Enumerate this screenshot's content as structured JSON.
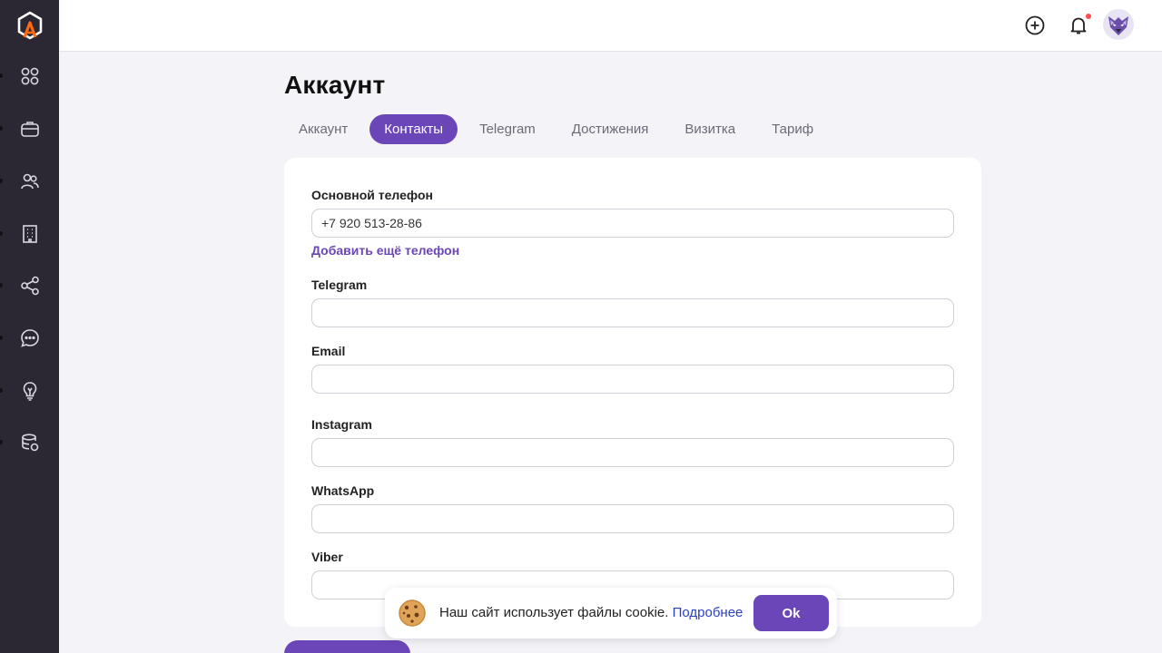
{
  "page": {
    "title": "Аккаунт"
  },
  "colors": {
    "accent": "#6b46b8",
    "sidebar_bg": "#2b2833",
    "logo_orange": "#ff6a13",
    "link_blue": "#2a3fbf",
    "notification_dot": "#ff4d4f"
  },
  "sidebar": {
    "items": [
      {
        "icon": "grid-icon"
      },
      {
        "icon": "briefcase-icon"
      },
      {
        "icon": "users-icon"
      },
      {
        "icon": "building-icon"
      },
      {
        "icon": "share-icon"
      },
      {
        "icon": "chat-icon"
      },
      {
        "icon": "lightbulb-icon"
      },
      {
        "icon": "database-icon"
      }
    ]
  },
  "topbar": {
    "icons": [
      "add-circle-icon",
      "bell-icon",
      "avatar"
    ]
  },
  "tabs": [
    {
      "label": "Аккаунт",
      "active": false
    },
    {
      "label": "Контакты",
      "active": true
    },
    {
      "label": "Telegram",
      "active": false
    },
    {
      "label": "Достижения",
      "active": false
    },
    {
      "label": "Визитка",
      "active": false
    },
    {
      "label": "Тариф",
      "active": false
    }
  ],
  "form": {
    "phone": {
      "label": "Основной телефон",
      "value": "+7 920 513-28-86"
    },
    "add_phone_link": "Добавить ещё телефон",
    "telegram": {
      "label": "Telegram",
      "value": ""
    },
    "email": {
      "label": "Email",
      "value": ""
    },
    "instagram": {
      "label": "Instagram",
      "value": ""
    },
    "whatsapp": {
      "label": "WhatsApp",
      "value": ""
    },
    "viber": {
      "label": "Viber",
      "value": ""
    }
  },
  "cookie_banner": {
    "text": "Наш сайт использует файлы cookie.",
    "link": "Подробнее",
    "button": "Ok"
  }
}
